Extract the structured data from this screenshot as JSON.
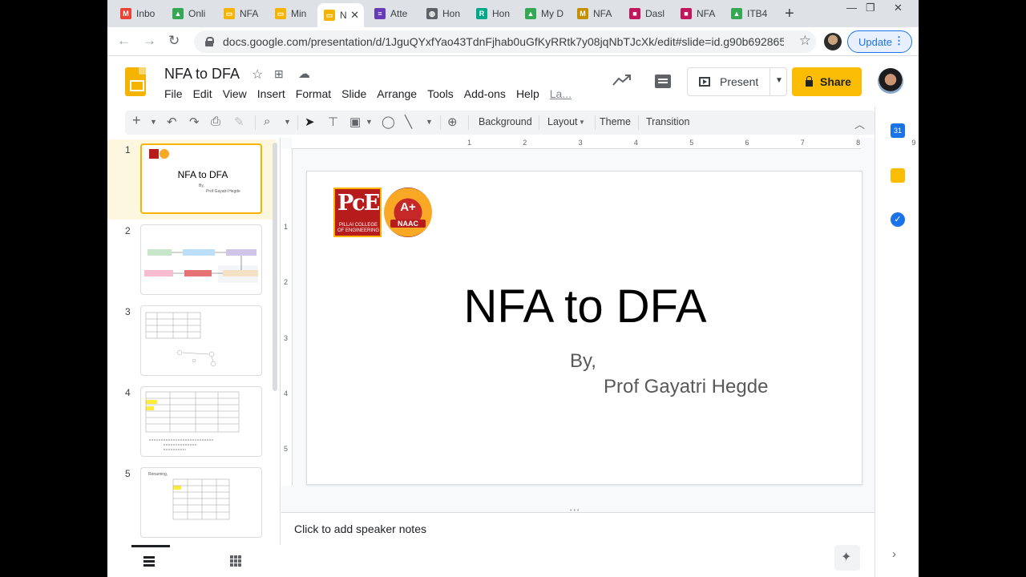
{
  "browser": {
    "tabs": [
      {
        "label": "Inbo",
        "icon": "gmail-icon",
        "color": "#ea4335",
        "glyph": "M"
      },
      {
        "label": "Onli",
        "icon": "drive-icon",
        "color": "#34a853",
        "glyph": "▲"
      },
      {
        "label": "NFA",
        "icon": "slides-icon",
        "color": "#f4b400",
        "glyph": "▭"
      },
      {
        "label": "Min",
        "icon": "slides-icon",
        "color": "#f4b400",
        "glyph": "▭"
      },
      {
        "label": "N",
        "icon": "slides-icon",
        "color": "#f4b400",
        "glyph": "▭",
        "active": true
      },
      {
        "label": "Atte",
        "icon": "forms-icon",
        "color": "#673ab7",
        "glyph": "≡"
      },
      {
        "label": "Hon",
        "icon": "globe-icon",
        "color": "#5f6368",
        "glyph": "◍"
      },
      {
        "label": "Hon",
        "icon": "r-icon",
        "color": "#00a88a",
        "glyph": "R"
      },
      {
        "label": "My D",
        "icon": "drive-icon",
        "color": "#34a853",
        "glyph": "▲"
      },
      {
        "label": "NFA",
        "icon": "m-icon",
        "color": "#c59000",
        "glyph": "M"
      },
      {
        "label": "Dasl",
        "icon": "app-icon",
        "color": "#c2185b",
        "glyph": "■"
      },
      {
        "label": "NFA",
        "icon": "app-icon",
        "color": "#c2185b",
        "glyph": "■"
      },
      {
        "label": "ITB4",
        "icon": "drive-icon",
        "color": "#34a853",
        "glyph": "▲"
      }
    ],
    "url": "docs.google.com/presentation/d/1JguQYxfYao43TdnFjhab0uGfKyRRtk7y08jqNbTJcXk/edit#slide=id.g90b692865...",
    "update_label": "Update"
  },
  "app": {
    "title": "NFA to DFA",
    "menu": [
      "File",
      "Edit",
      "View",
      "Insert",
      "Format",
      "Slide",
      "Arrange",
      "Tools",
      "Add-ons",
      "Help",
      "La..."
    ],
    "present_label": "Present",
    "share_label": "Share"
  },
  "toolbar": {
    "background_label": "Background",
    "layout_label": "Layout",
    "theme_label": "Theme",
    "transition_label": "Transition"
  },
  "ruler": {
    "h": [
      "1",
      "2",
      "3",
      "4",
      "5",
      "6",
      "7",
      "8",
      "9"
    ],
    "v": [
      "1",
      "2",
      "3",
      "4",
      "5"
    ]
  },
  "filmstrip": {
    "numbers": [
      "1",
      "2",
      "3",
      "4",
      "5"
    ],
    "thumb1_title": "NFA to DFA",
    "thumb1_by": "By,",
    "thumb1_author": "Prof Gayatri Hegde",
    "thumb5_text": "Renaming,"
  },
  "slide": {
    "title": "NFA to DFA",
    "by": "By,",
    "author": "Prof Gayatri Hegde",
    "logo_text": "PcE",
    "logo_sub": "PILLAI COLLEGE OF ENGINEERING",
    "naac_grade": "A+",
    "naac_label": "NAAC"
  },
  "notes": {
    "placeholder": "Click to add speaker notes"
  },
  "colors": {
    "accent": "#f4b400",
    "share": "#fbbc04",
    "link": "#1a73e8"
  }
}
